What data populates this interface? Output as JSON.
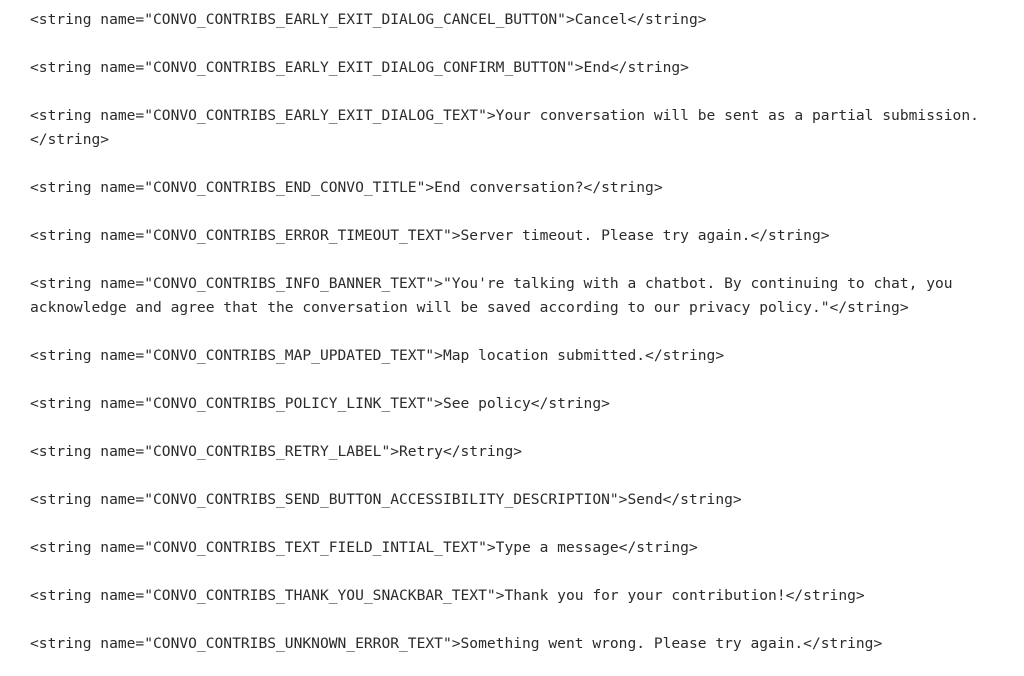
{
  "document": {
    "type": "android-string-resources",
    "background_color": "#ffffff",
    "text_color": "#2b2b2b",
    "tag_open_prefix": "<string name=\"",
    "tag_open_suffix": "\">",
    "tag_close": "</string>",
    "entries": [
      {
        "name": "CONVO_CONTRIBS_EARLY_EXIT_DIALOG_CANCEL_BUTTON",
        "value": "Cancel",
        "line": "<string name=\"CONVO_CONTRIBS_EARLY_EXIT_DIALOG_CANCEL_BUTTON\">Cancel</string>"
      },
      {
        "name": "CONVO_CONTRIBS_EARLY_EXIT_DIALOG_CONFIRM_BUTTON",
        "value": "End",
        "line": "<string name=\"CONVO_CONTRIBS_EARLY_EXIT_DIALOG_CONFIRM_BUTTON\">End</string>"
      },
      {
        "name": "CONVO_CONTRIBS_EARLY_EXIT_DIALOG_TEXT",
        "value": "Your conversation will be sent as a partial submission.",
        "line": "<string name=\"CONVO_CONTRIBS_EARLY_EXIT_DIALOG_TEXT\">Your conversation will be sent as a partial submission.</string>"
      },
      {
        "name": "CONVO_CONTRIBS_END_CONVO_TITLE",
        "value": "End conversation?",
        "line": "<string name=\"CONVO_CONTRIBS_END_CONVO_TITLE\">End conversation?</string>"
      },
      {
        "name": "CONVO_CONTRIBS_ERROR_TIMEOUT_TEXT",
        "value": "Server timeout. Please try again.",
        "line": "<string name=\"CONVO_CONTRIBS_ERROR_TIMEOUT_TEXT\">Server timeout. Please try again.</string>"
      },
      {
        "name": "CONVO_CONTRIBS_INFO_BANNER_TEXT",
        "value": "\"You're talking with a chatbot. By continuing to chat, you acknowledge and agree that the conversation will be saved according to our privacy policy.\"",
        "line": "<string name=\"CONVO_CONTRIBS_INFO_BANNER_TEXT\">\"You're talking with a chatbot. By continuing to chat, you acknowledge and agree that the conversation will be saved according to our privacy policy.\"</string>"
      },
      {
        "name": "CONVO_CONTRIBS_MAP_UPDATED_TEXT",
        "value": "Map location submitted.",
        "line": "<string name=\"CONVO_CONTRIBS_MAP_UPDATED_TEXT\">Map location submitted.</string>"
      },
      {
        "name": "CONVO_CONTRIBS_POLICY_LINK_TEXT",
        "value": "See policy",
        "line": "<string name=\"CONVO_CONTRIBS_POLICY_LINK_TEXT\">See policy</string>"
      },
      {
        "name": "CONVO_CONTRIBS_RETRY_LABEL",
        "value": "Retry",
        "line": "<string name=\"CONVO_CONTRIBS_RETRY_LABEL\">Retry</string>"
      },
      {
        "name": "CONVO_CONTRIBS_SEND_BUTTON_ACCESSIBILITY_DESCRIPTION",
        "value": "Send",
        "line": "<string name=\"CONVO_CONTRIBS_SEND_BUTTON_ACCESSIBILITY_DESCRIPTION\">Send</string>"
      },
      {
        "name": "CONVO_CONTRIBS_TEXT_FIELD_INTIAL_TEXT",
        "value": "Type a message",
        "line": "<string name=\"CONVO_CONTRIBS_TEXT_FIELD_INTIAL_TEXT\">Type a message</string>"
      },
      {
        "name": "CONVO_CONTRIBS_THANK_YOU_SNACKBAR_TEXT",
        "value": "Thank you for your contribution!",
        "line": "<string name=\"CONVO_CONTRIBS_THANK_YOU_SNACKBAR_TEXT\">Thank you for your contribution!</string>"
      },
      {
        "name": "CONVO_CONTRIBS_UNKNOWN_ERROR_TEXT",
        "value": "Something went wrong. Please try again.",
        "line": "<string name=\"CONVO_CONTRIBS_UNKNOWN_ERROR_TEXT\">Something went wrong. Please try again.</string>"
      }
    ]
  }
}
